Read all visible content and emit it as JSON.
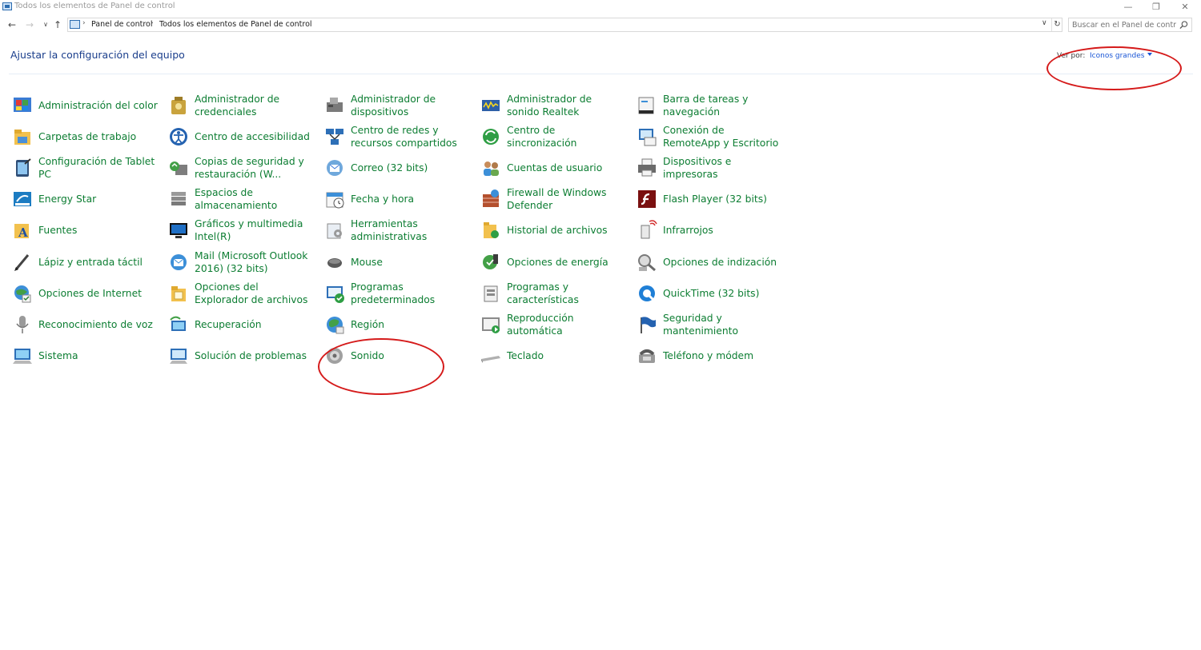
{
  "window": {
    "title": "Todos los elementos de Panel de control"
  },
  "address_bar": {
    "crumbs": [
      "Panel de control",
      "Todos los elementos de Panel de control"
    ],
    "search_placeholder": "Buscar en el Panel de control"
  },
  "header": {
    "heading": "Ajustar la configuración del equipo",
    "view_by_label": "Ver por:",
    "view_by_value": "Iconos grandes"
  },
  "items": [
    {
      "label": "Administración del color",
      "icon": "color-management-icon"
    },
    {
      "label": "Carpetas de trabajo",
      "icon": "work-folders-icon"
    },
    {
      "label": "Configuración de Tablet PC",
      "icon": "tablet-pc-icon"
    },
    {
      "label": "Energy Star",
      "icon": "energy-star-icon"
    },
    {
      "label": "Fuentes",
      "icon": "fonts-icon"
    },
    {
      "label": "Lápiz y entrada táctil",
      "icon": "pen-touch-icon"
    },
    {
      "label": "Opciones de Internet",
      "icon": "internet-options-icon"
    },
    {
      "label": "Reconocimiento de voz",
      "icon": "microphone-icon"
    },
    {
      "label": "Sistema",
      "icon": "system-icon"
    },
    {
      "label": "Administrador de credenciales",
      "icon": "credential-manager-icon"
    },
    {
      "label": "Centro de accesibilidad",
      "icon": "accessibility-icon"
    },
    {
      "label": "Copias de seguridad y restauración (W...",
      "icon": "backup-restore-icon"
    },
    {
      "label": "Espacios de almacenamiento",
      "icon": "storage-spaces-icon"
    },
    {
      "label": "Gráficos y multimedia Intel(R)",
      "icon": "intel-graphics-icon"
    },
    {
      "label": "Mail (Microsoft Outlook 2016) (32 bits)",
      "icon": "mail-icon"
    },
    {
      "label": "Opciones del Explorador de archivos",
      "icon": "folder-options-icon"
    },
    {
      "label": "Recuperación",
      "icon": "recovery-icon"
    },
    {
      "label": "Solución de problemas",
      "icon": "troubleshooting-icon"
    },
    {
      "label": "Administrador de dispositivos",
      "icon": "device-manager-icon"
    },
    {
      "label": "Centro de redes y recursos compartidos",
      "icon": "network-center-icon"
    },
    {
      "label": "Correo (32 bits)",
      "icon": "mail-32-icon"
    },
    {
      "label": "Fecha y hora",
      "icon": "date-time-icon"
    },
    {
      "label": "Herramientas administrativas",
      "icon": "admin-tools-icon"
    },
    {
      "label": "Mouse",
      "icon": "mouse-icon"
    },
    {
      "label": "Programas predeterminados",
      "icon": "default-programs-icon"
    },
    {
      "label": "Región",
      "icon": "region-icon"
    },
    {
      "label": "Sonido",
      "icon": "sound-icon"
    },
    {
      "label": "Administrador de sonido Realtek",
      "icon": "realtek-audio-icon"
    },
    {
      "label": "Centro de sincronización",
      "icon": "sync-center-icon"
    },
    {
      "label": "Cuentas de usuario",
      "icon": "user-accounts-icon"
    },
    {
      "label": "Firewall de Windows Defender",
      "icon": "firewall-icon"
    },
    {
      "label": "Historial de archivos",
      "icon": "file-history-icon"
    },
    {
      "label": "Opciones de energía",
      "icon": "power-options-icon"
    },
    {
      "label": "Programas y características",
      "icon": "programs-features-icon"
    },
    {
      "label": "Reproducción automática",
      "icon": "autoplay-icon"
    },
    {
      "label": "Teclado",
      "icon": "keyboard-icon"
    },
    {
      "label": "Barra de tareas y navegación",
      "icon": "taskbar-icon"
    },
    {
      "label": "Conexión de RemoteApp y Escritorio",
      "icon": "remoteapp-icon"
    },
    {
      "label": "Dispositivos e impresoras",
      "icon": "printer-icon"
    },
    {
      "label": "Flash Player (32 bits)",
      "icon": "flash-player-icon"
    },
    {
      "label": "Infrarrojos",
      "icon": "infrared-icon"
    },
    {
      "label": "Opciones de indización",
      "icon": "indexing-icon"
    },
    {
      "label": "QuickTime (32 bits)",
      "icon": "quicktime-icon"
    },
    {
      "label": "Seguridad y mantenimiento",
      "icon": "security-maintenance-icon"
    },
    {
      "label": "Teléfono y módem",
      "icon": "phone-modem-icon"
    }
  ],
  "colors": {
    "link": "#0c7d32",
    "heading": "#1a3e8c",
    "accent": "#1a56d6",
    "annotation": "#d51a1a"
  }
}
